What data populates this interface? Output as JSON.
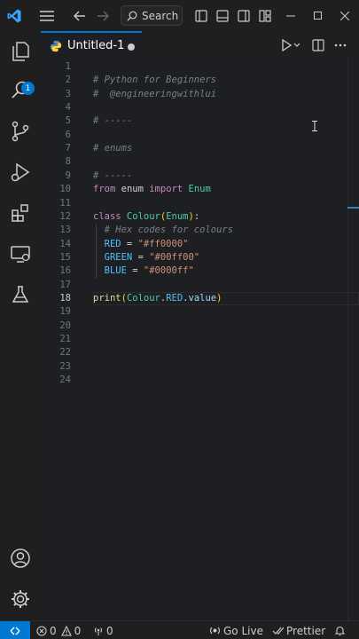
{
  "titlebar": {
    "search_label": "Search"
  },
  "activity_badge": "1",
  "tab": {
    "title": "Untitled-1"
  },
  "editor": {
    "active_line": 18,
    "lines": [
      {
        "n": "1",
        "tokens": []
      },
      {
        "n": "2",
        "tokens": [
          {
            "t": "# Python for Beginners",
            "c": "c-com"
          }
        ]
      },
      {
        "n": "3",
        "tokens": [
          {
            "t": "#  @engineeringwithlui",
            "c": "c-com"
          }
        ]
      },
      {
        "n": "4",
        "tokens": []
      },
      {
        "n": "5",
        "tokens": [
          {
            "t": "# -----",
            "c": "c-com"
          }
        ]
      },
      {
        "n": "6",
        "tokens": []
      },
      {
        "n": "7",
        "tokens": [
          {
            "t": "# enums",
            "c": "c-com"
          }
        ]
      },
      {
        "n": "8",
        "tokens": []
      },
      {
        "n": "9",
        "tokens": [
          {
            "t": "# -----",
            "c": "c-com"
          }
        ]
      },
      {
        "n": "10",
        "tokens": [
          {
            "t": "from",
            "c": "c-kw"
          },
          {
            "t": " enum ",
            "c": "c-plain"
          },
          {
            "t": "import",
            "c": "c-kw"
          },
          {
            "t": " Enum",
            "c": "c-cls"
          }
        ]
      },
      {
        "n": "11",
        "tokens": []
      },
      {
        "n": "12",
        "tokens": [
          {
            "t": "class",
            "c": "c-kw"
          },
          {
            "t": " Colour",
            "c": "c-cls"
          },
          {
            "t": "(",
            "c": "c-brk"
          },
          {
            "t": "Enum",
            "c": "c-cls"
          },
          {
            "t": ")",
            "c": "c-brk"
          },
          {
            "t": ":",
            "c": "c-plain"
          }
        ]
      },
      {
        "n": "13",
        "tokens": [
          {
            "t": "  # Hex codes for colours",
            "c": "c-com"
          }
        ]
      },
      {
        "n": "14",
        "tokens": [
          {
            "t": "  RED",
            "c": "c-var"
          },
          {
            "t": " = ",
            "c": "c-plain"
          },
          {
            "t": "\"#ff0000\"",
            "c": "c-str"
          }
        ]
      },
      {
        "n": "15",
        "tokens": [
          {
            "t": "  GREEN",
            "c": "c-var"
          },
          {
            "t": " = ",
            "c": "c-plain"
          },
          {
            "t": "\"#00ff00\"",
            "c": "c-str"
          }
        ]
      },
      {
        "n": "16",
        "tokens": [
          {
            "t": "  BLUE",
            "c": "c-var"
          },
          {
            "t": " = ",
            "c": "c-plain"
          },
          {
            "t": "\"#0000ff\"",
            "c": "c-str"
          }
        ]
      },
      {
        "n": "17",
        "tokens": []
      },
      {
        "n": "18",
        "tokens": [
          {
            "t": "print",
            "c": "c-fn"
          },
          {
            "t": "(",
            "c": "c-brk"
          },
          {
            "t": "Colour",
            "c": "c-cls"
          },
          {
            "t": ".",
            "c": "c-plain"
          },
          {
            "t": "RED",
            "c": "c-var"
          },
          {
            "t": ".",
            "c": "c-plain"
          },
          {
            "t": "value",
            "c": "c-ident"
          },
          {
            "t": ")",
            "c": "c-brk"
          }
        ]
      },
      {
        "n": "19",
        "tokens": []
      },
      {
        "n": "20",
        "tokens": []
      },
      {
        "n": "21",
        "tokens": []
      },
      {
        "n": "22",
        "tokens": []
      },
      {
        "n": "23",
        "tokens": []
      },
      {
        "n": "24",
        "tokens": []
      }
    ]
  },
  "statusbar": {
    "errors": "0",
    "warnings": "0",
    "ports": "0",
    "go_live": "Go Live",
    "prettier": "Prettier"
  },
  "colors": {
    "accent": "#0078d4",
    "background": "#1e1f22"
  }
}
